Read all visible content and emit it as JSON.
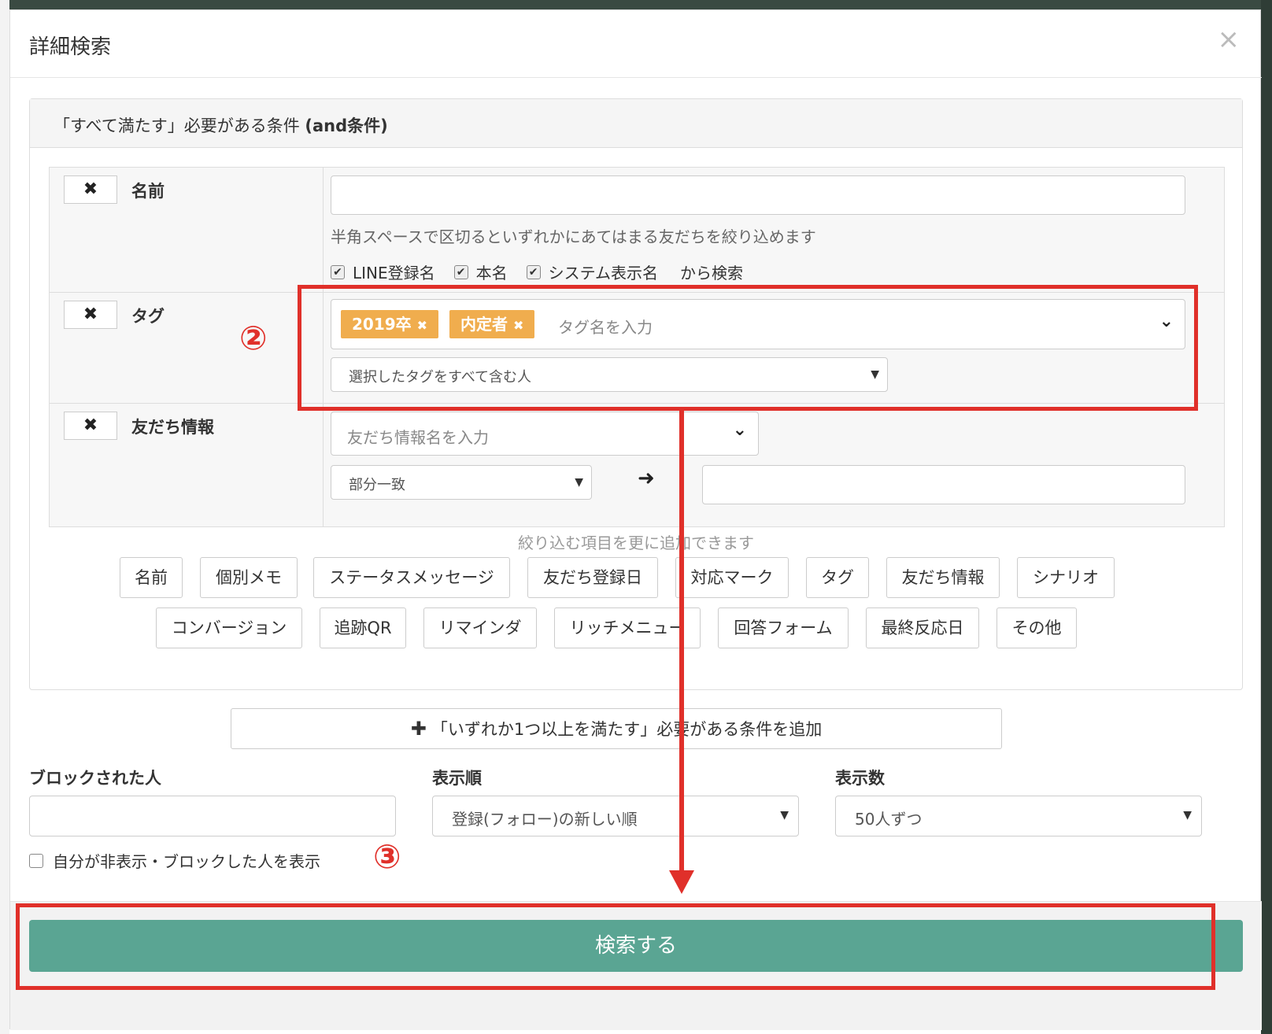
{
  "modal": {
    "title": "詳細検索",
    "close_label": "×"
  },
  "and_panel": {
    "heading_prefix": "「すべて満たす」必要がある条件",
    "heading_bold": "(and条件)"
  },
  "conditions": {
    "remove_label": "✖",
    "name": {
      "label": "名前",
      "input_value": "",
      "help": "半角スペースで区切るといずれかにあてはまる友だちを絞り込めます",
      "checks": [
        {
          "label": "LINE登録名",
          "checked": true
        },
        {
          "label": "本名",
          "checked": true
        },
        {
          "label": "システム表示名",
          "checked": true
        }
      ],
      "checks_suffix": "から検索"
    },
    "tag": {
      "label": "タグ",
      "chips": [
        "2019卒",
        "内定者"
      ],
      "chip_remove": "✖",
      "placeholder": "タグ名を入力",
      "match_mode": "選択したタグをすべて含む人"
    },
    "friend_info": {
      "label": "友だち情報",
      "placeholder": "友だち情報名を入力",
      "match_mode": "部分一致",
      "value": ""
    }
  },
  "add_items": {
    "hint": "絞り込む項目を更に追加できます",
    "row1": [
      "名前",
      "個別メモ",
      "ステータスメッセージ",
      "友だち登録日",
      "対応マーク",
      "タグ",
      "友だち情報",
      "シナリオ"
    ],
    "row2": [
      "コンバージョン",
      "追跡QR",
      "リマインダ",
      "リッチメニュー",
      "回答フォーム",
      "最終反応日",
      "その他"
    ]
  },
  "or_button": {
    "plus": "✚",
    "label": "「いずれか1つ以上を満たす」必要がある条件を追加"
  },
  "options": {
    "blocked_label": "ブロックされた人",
    "blocked_value": "",
    "order_label": "表示順",
    "order_value": "登録(フォロー)の新しい順",
    "count_label": "表示数",
    "count_value": "50人ずつ",
    "show_hidden_label": "自分が非表示・ブロックした人を表示",
    "show_hidden_checked": false
  },
  "search_button": "検索する",
  "annotations": {
    "marker2": "②",
    "marker3": "③"
  },
  "colors": {
    "tag_chip": "#f0ad4e",
    "search_button": "#5aa593",
    "highlight": "#e0302a"
  }
}
